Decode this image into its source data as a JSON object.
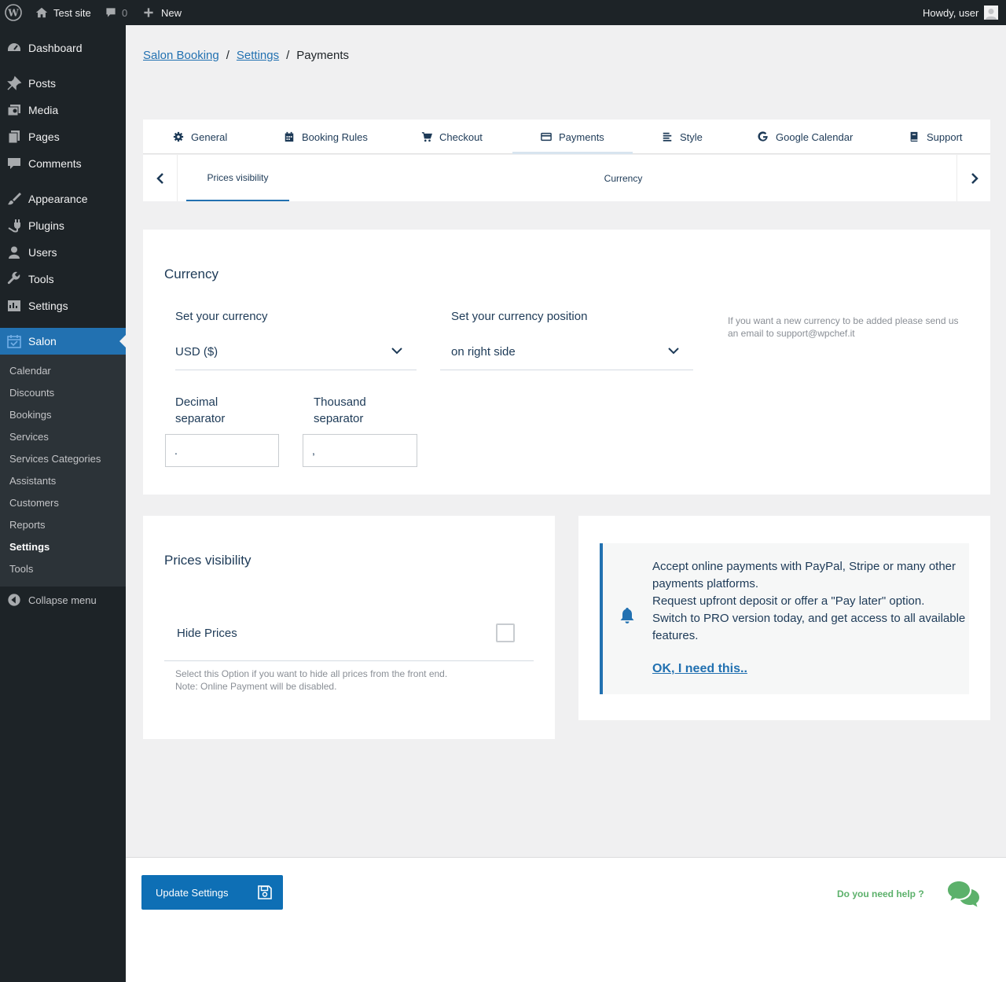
{
  "admin_bar": {
    "site_name": "Test site",
    "comments_count": "0",
    "new_label": "New",
    "greeting": "Howdy, user"
  },
  "sidebar": {
    "items": [
      {
        "label": "Dashboard",
        "icon": "dashboard-icon"
      },
      {
        "label": "Posts",
        "icon": "pin-icon"
      },
      {
        "label": "Media",
        "icon": "media-icon"
      },
      {
        "label": "Pages",
        "icon": "pages-icon"
      },
      {
        "label": "Comments",
        "icon": "comment-icon"
      },
      {
        "label": "Appearance",
        "icon": "brush-icon"
      },
      {
        "label": "Plugins",
        "icon": "plug-icon"
      },
      {
        "label": "Users",
        "icon": "user-icon"
      },
      {
        "label": "Tools",
        "icon": "wrench-icon"
      },
      {
        "label": "Settings",
        "icon": "settings-icon"
      },
      {
        "label": "Salon",
        "icon": "calendar-icon"
      }
    ],
    "submenu": [
      "Calendar",
      "Discounts",
      "Bookings",
      "Services",
      "Services Categories",
      "Assistants",
      "Customers",
      "Reports",
      "Settings",
      "Tools"
    ],
    "collapse_label": "Collapse menu"
  },
  "breadcrumb": {
    "root": "Salon Booking",
    "parent": "Settings",
    "current": "Payments",
    "separator": "/"
  },
  "tabs": [
    {
      "label": "General",
      "icon": "gear-icon"
    },
    {
      "label": "Booking Rules",
      "icon": "calendar-icon"
    },
    {
      "label": "Checkout",
      "icon": "cart-icon"
    },
    {
      "label": "Payments",
      "icon": "credit-card-icon"
    },
    {
      "label": "Style",
      "icon": "align-left-icon"
    },
    {
      "label": "Google Calendar",
      "icon": "google-icon"
    },
    {
      "label": "Support",
      "icon": "book-icon"
    }
  ],
  "subtabs": [
    "Prices visibility",
    "Currency"
  ],
  "currency": {
    "title": "Currency",
    "currency_label": "Set your currency",
    "currency_value": "USD ($)",
    "position_label": "Set your currency position",
    "position_value": "on right side",
    "note": "If you want a new currency to be added please send us an email to support@wpchef.it",
    "decimal_label": "Decimal separator",
    "decimal_value": ".",
    "thousand_label": "Thousand separator",
    "thousand_value": ","
  },
  "prices_visibility": {
    "title": "Prices visibility",
    "hide_label": "Hide Prices",
    "hide_checked": false,
    "help": "Select this Option if you want to hide all prices from the front end.\nNote: Online Payment will be disabled."
  },
  "promo": {
    "text": "Accept online payments with PayPal, Stripe or many other payments platforms.\nRequest upfront deposit or offer a \"Pay later\" option.\nSwitch to PRO version today, and get access to all available features.",
    "link": "OK, I need this.."
  },
  "footer": {
    "update_label": "Update Settings",
    "help_label": "Do you need help ?"
  },
  "colors": {
    "accent": "#2271b1",
    "sidebar_bg": "#1d2327",
    "help_green": "#5cb16b"
  }
}
